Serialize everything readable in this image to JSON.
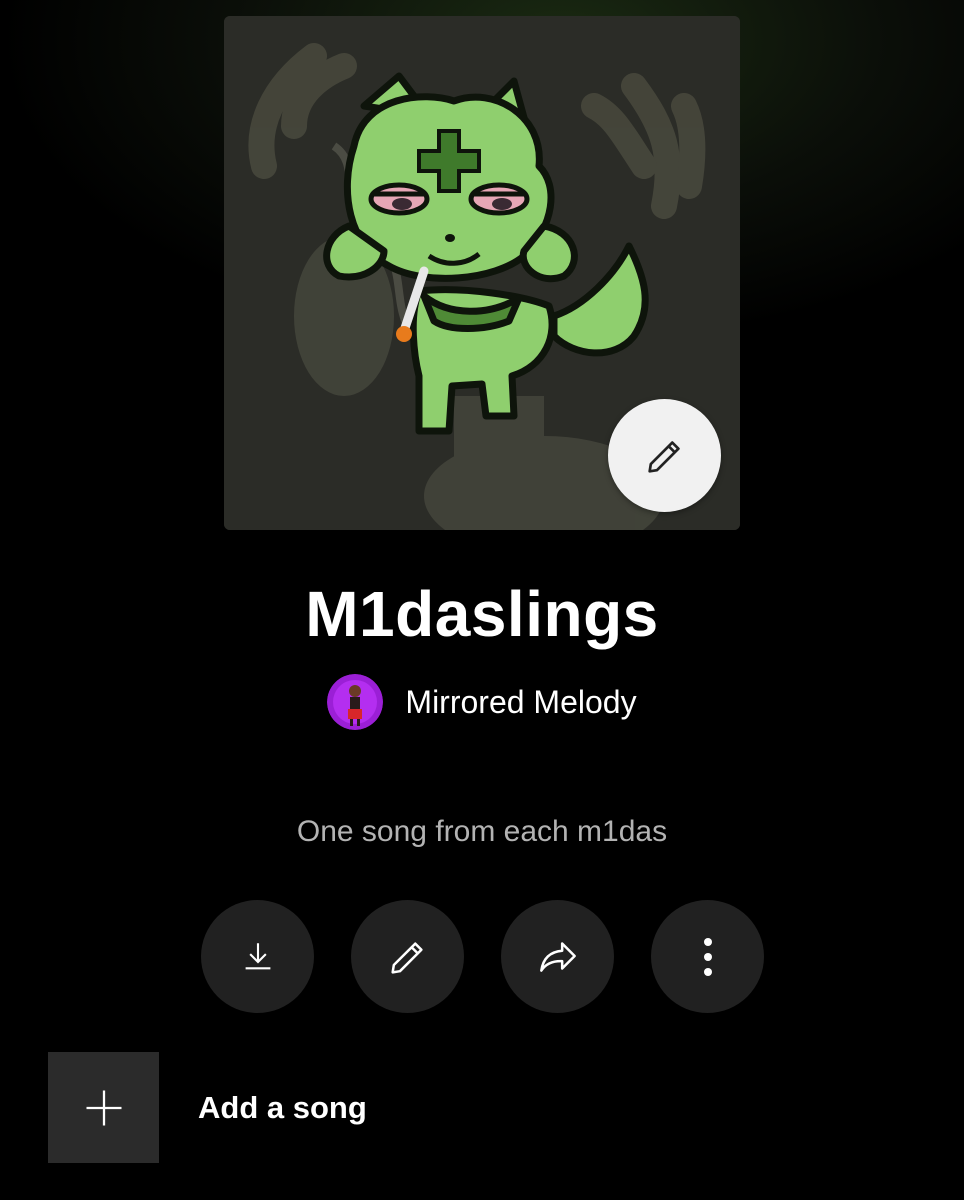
{
  "playlist": {
    "title": "M1daslings",
    "owner_name": "Mirrored Melody",
    "description": "One song from each m1das"
  },
  "cover": {
    "edit_icon": "pencil-icon"
  },
  "actions": [
    {
      "id": "download",
      "icon": "download-icon"
    },
    {
      "id": "edit",
      "icon": "pencil-icon"
    },
    {
      "id": "share",
      "icon": "share-icon"
    },
    {
      "id": "more",
      "icon": "more-vertical-icon"
    }
  ],
  "add_song": {
    "label": "Add a song",
    "icon": "plus-icon"
  },
  "colors": {
    "background": "#000000",
    "button_bg": "#212121",
    "secondary_text": "#b3b3b3",
    "owner_avatar_ring": "#9b1fd6"
  }
}
